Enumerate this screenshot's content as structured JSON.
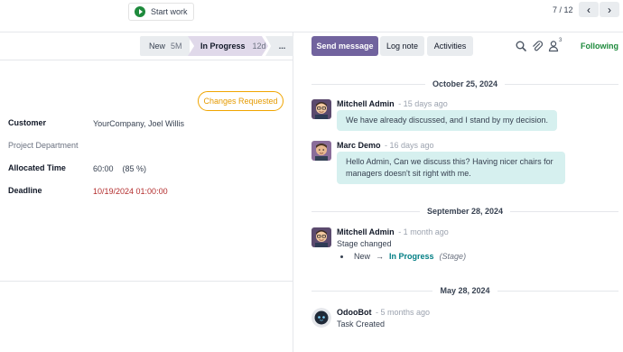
{
  "topbar": {
    "start_work_label": "Start work",
    "pager": "7 / 12",
    "prev_glyph": "‹",
    "next_glyph": "›"
  },
  "form": {
    "stages": [
      {
        "label": "New",
        "count": "5M"
      },
      {
        "label": "In Progress",
        "count": "12d"
      },
      {
        "label": "..."
      }
    ],
    "badge": "Changes Requested",
    "fields": {
      "customer_label": "Customer",
      "customer_value": "YourCompany, Joel Willis",
      "department_label": "Project Department",
      "allocated_label": "Allocated Time",
      "allocated_value": "60:00",
      "allocated_pct": "(85 %)",
      "deadline_label": "Deadline",
      "deadline_value": "10/19/2024 01:00:00"
    },
    "colors": {
      "deadline": "#b32d2d",
      "badge": "#f0a500",
      "active_stage": "#e0d9ea"
    }
  },
  "chatter": {
    "toolbar": {
      "send_message": "Send message",
      "log_note": "Log note",
      "activities": "Activities",
      "follower_count": "3",
      "following": "Following"
    },
    "colors": {
      "primary": "#71639e",
      "following": "#1e8a3c",
      "bubble": "#d6f0ef",
      "tracking_value": "#017e84"
    },
    "groups": [
      {
        "date": "October 25, 2024",
        "messages": [
          {
            "author": "Mitchell Admin",
            "when": "- 15 days ago",
            "body": "We have already discussed, and I stand by my decision."
          },
          {
            "author": "Marc Demo",
            "when": "- 16 days ago",
            "body_line1": "Hello Admin, Can we discuss this? Having nicer chairs for",
            "body_line2": "managers doesn't sit right with me."
          }
        ]
      },
      {
        "date": "September 28, 2024",
        "messages": [
          {
            "author": "Mitchell Admin",
            "when": "- 1 month ago",
            "body": "Stage changed",
            "old_value": "New",
            "arrow": "→",
            "new_value": "In Progress",
            "field": "(Stage)"
          }
        ]
      },
      {
        "date": "May 28, 2024",
        "messages": [
          {
            "author": "OdooBot",
            "when": "- 5 months ago",
            "body": "Task Created"
          }
        ]
      }
    ]
  }
}
